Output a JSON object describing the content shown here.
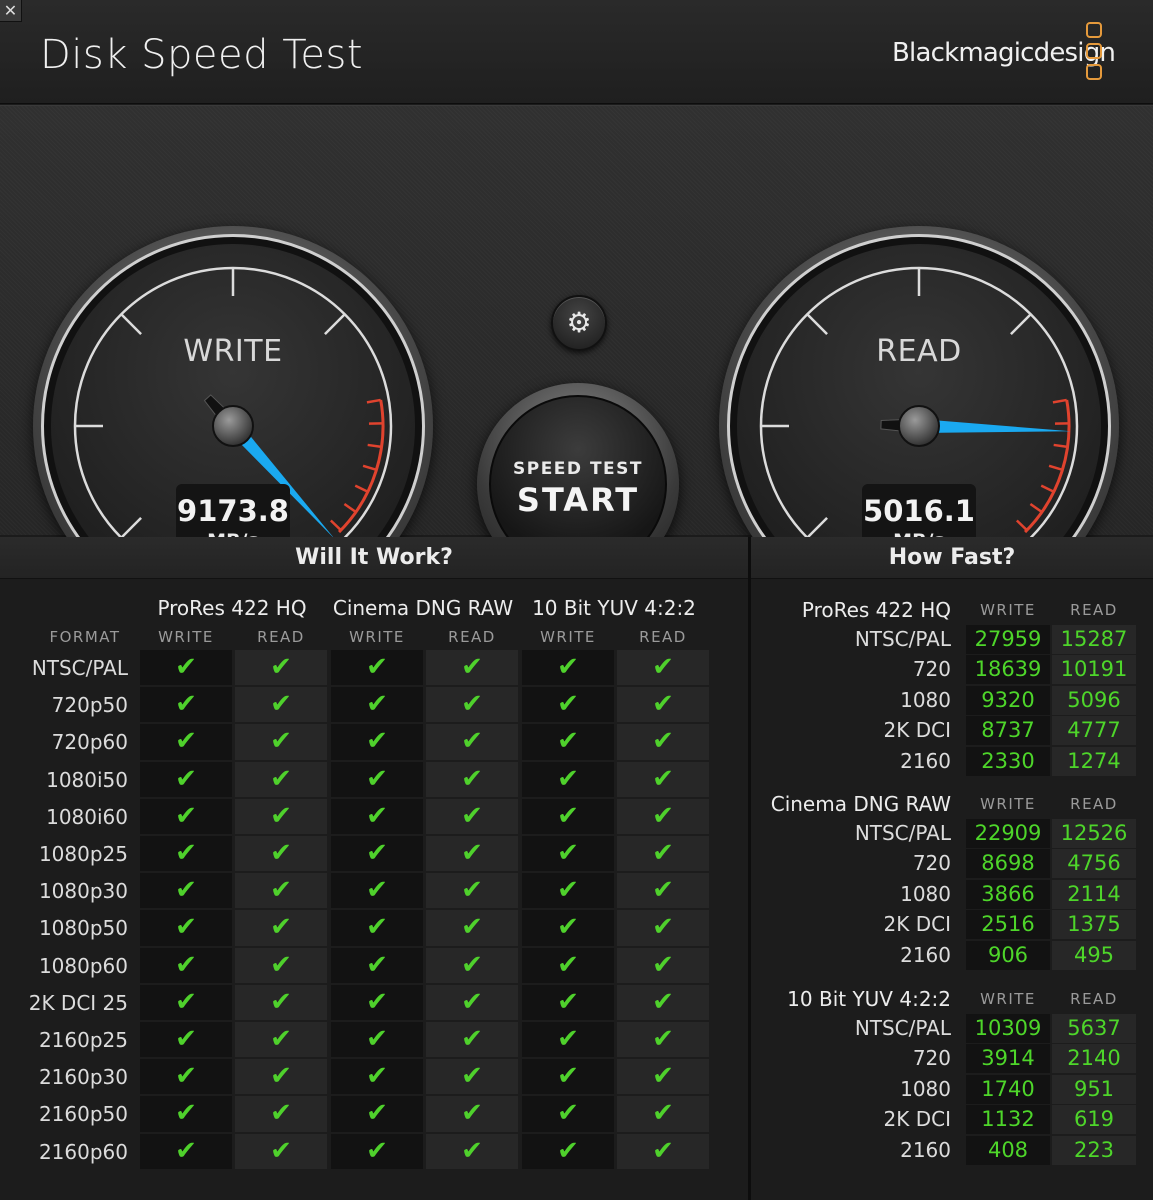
{
  "window": {
    "close_glyph": "✕"
  },
  "header": {
    "title": "Disk Speed Test",
    "brand": "Blackmagicdesign",
    "brand_color": "#e59a3c"
  },
  "gauges": {
    "write": {
      "label": "WRITE",
      "value": "9173.8",
      "unit": "MB/s"
    },
    "read": {
      "label": "READ",
      "value": "5016.1",
      "unit": "MB/s"
    },
    "needle_color": "#1aa9f0",
    "redline_color": "#e0432e"
  },
  "controls": {
    "settings_icon": "gear-icon",
    "settings_glyph": "⚙",
    "start_small": "SPEED TEST",
    "start_big": "START"
  },
  "will_it_work": {
    "title": "Will It Work?",
    "format_header": "FORMAT",
    "groups": [
      "ProRes 422 HQ",
      "Cinema DNG RAW",
      "10 Bit YUV 4:2:2"
    ],
    "write_label": "WRITE",
    "read_label": "READ",
    "check_glyph": "✔",
    "check_color": "#4fd12c",
    "formats": [
      "NTSC/PAL",
      "720p50",
      "720p60",
      "1080i50",
      "1080i60",
      "1080p25",
      "1080p30",
      "1080p50",
      "1080p60",
      "2K DCI 25",
      "2160p25",
      "2160p30",
      "2160p50",
      "2160p60"
    ]
  },
  "how_fast": {
    "title": "How Fast?",
    "write_label": "WRITE",
    "read_label": "READ",
    "groups": [
      {
        "name": "ProRes 422 HQ",
        "rows": [
          {
            "label": "NTSC/PAL",
            "write": "27959",
            "read": "15287"
          },
          {
            "label": "720",
            "write": "18639",
            "read": "10191"
          },
          {
            "label": "1080",
            "write": "9320",
            "read": "5096"
          },
          {
            "label": "2K DCI",
            "write": "8737",
            "read": "4777"
          },
          {
            "label": "2160",
            "write": "2330",
            "read": "1274"
          }
        ]
      },
      {
        "name": "Cinema DNG RAW",
        "rows": [
          {
            "label": "NTSC/PAL",
            "write": "22909",
            "read": "12526"
          },
          {
            "label": "720",
            "write": "8698",
            "read": "4756"
          },
          {
            "label": "1080",
            "write": "3866",
            "read": "2114"
          },
          {
            "label": "2K DCI",
            "write": "2516",
            "read": "1375"
          },
          {
            "label": "2160",
            "write": "906",
            "read": "495"
          }
        ]
      },
      {
        "name": "10 Bit YUV 4:2:2",
        "rows": [
          {
            "label": "NTSC/PAL",
            "write": "10309",
            "read": "5637"
          },
          {
            "label": "720",
            "write": "3914",
            "read": "2140"
          },
          {
            "label": "1080",
            "write": "1740",
            "read": "951"
          },
          {
            "label": "2K DCI",
            "write": "1132",
            "read": "619"
          },
          {
            "label": "2160",
            "write": "408",
            "read": "223"
          }
        ]
      }
    ]
  }
}
